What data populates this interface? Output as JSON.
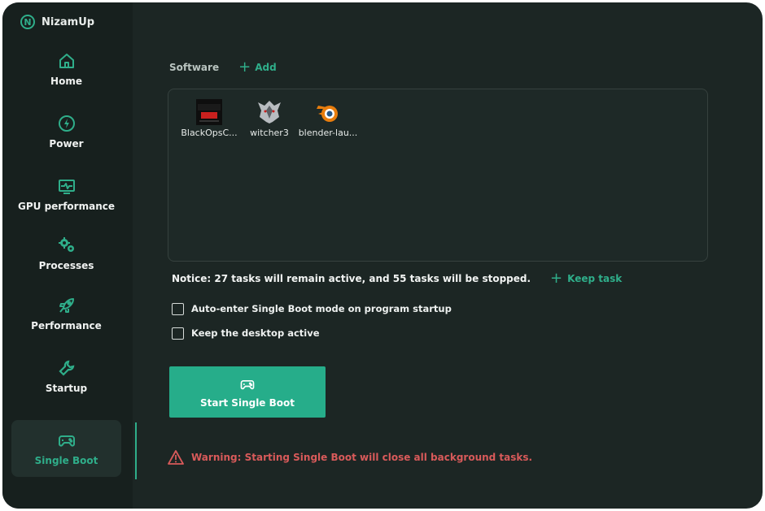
{
  "app": {
    "name": "NizamUp",
    "logo_letter": "N"
  },
  "sidebar": {
    "items": [
      {
        "label": "Home",
        "icon": "home-icon",
        "active": false
      },
      {
        "label": "Power",
        "icon": "power-icon",
        "active": false
      },
      {
        "label": "GPU performance",
        "icon": "gpu-monitor-icon",
        "active": false
      },
      {
        "label": "Processes",
        "icon": "gears-icon",
        "active": false
      },
      {
        "label": "Performance",
        "icon": "rocket-icon",
        "active": false
      },
      {
        "label": "Startup",
        "icon": "wrench-icon",
        "active": false
      },
      {
        "label": "Single Boot",
        "icon": "gamepad-icon",
        "active": true
      }
    ]
  },
  "software": {
    "title": "Software",
    "add_label": "Add",
    "apps": [
      {
        "name": "BlackOpsC...",
        "icon": "black-ops-icon"
      },
      {
        "name": "witcher3",
        "icon": "witcher-wolf-icon"
      },
      {
        "name": "blender-lau...",
        "icon": "blender-icon"
      }
    ]
  },
  "notice": {
    "text": "Notice: 27 tasks will remain active, and 55 tasks will be stopped.",
    "keep_label": "Keep task"
  },
  "options": [
    {
      "label": "Auto-enter Single Boot mode on program startup",
      "checked": false
    },
    {
      "label": "Keep the desktop active",
      "checked": false
    }
  ],
  "start_button": {
    "label": "Start Single Boot",
    "icon": "gamepad-icon"
  },
  "warning": {
    "text": "Warning: Starting Single Boot will close all background tasks.",
    "icon": "warning-triangle-icon"
  },
  "colors": {
    "accent": "#2fae8a",
    "warning": "#d85a5a",
    "background": "#1c2624",
    "sidebar": "#17201e"
  }
}
